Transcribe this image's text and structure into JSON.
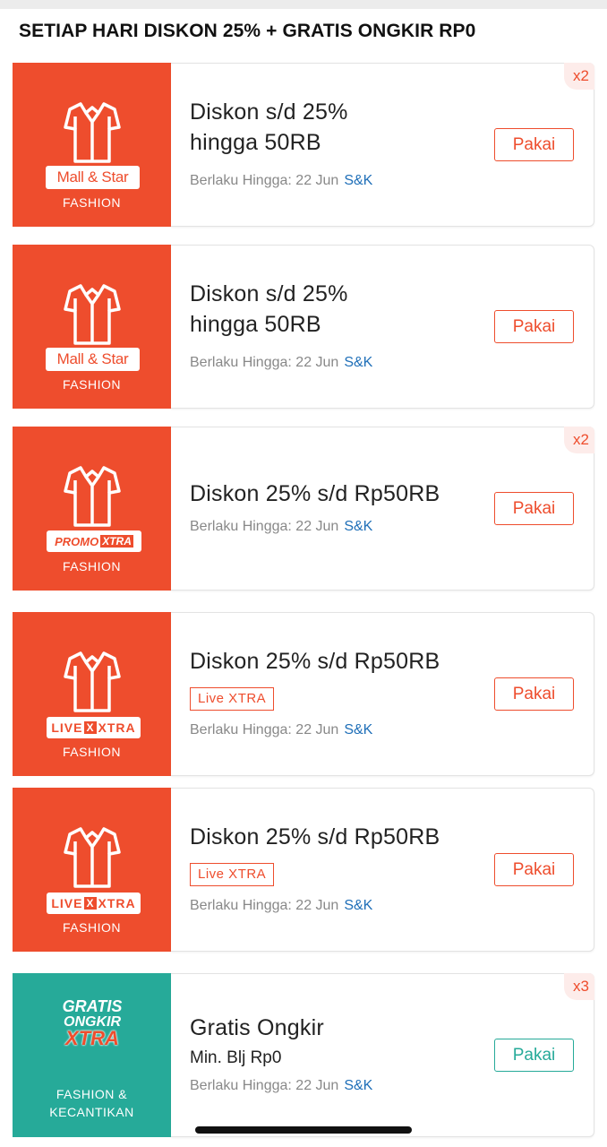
{
  "header": {
    "title": "SETIAP HARI DISKON 25% + GRATIS ONGKIR RP0"
  },
  "vouchers": [
    {
      "badge": "Mall & Star",
      "category": "FASHION",
      "title": "Diskon s/d 25%",
      "title2": "hingga 50RB",
      "validity": "Berlaku Hingga: 22 Jun",
      "terms": "S&K",
      "button": "Pakai",
      "multiplier": "x2"
    },
    {
      "badge": "Mall & Star",
      "category": "FASHION",
      "title": "Diskon s/d 25%",
      "title2": "hingga 50RB",
      "validity": "Berlaku Hingga: 22 Jun",
      "terms": "S&K",
      "button": "Pakai"
    },
    {
      "badge_a": "PROMO",
      "badge_b": "XTRA",
      "category": "FASHION",
      "title": "Diskon 25% s/d Rp50RB",
      "validity": "Berlaku Hingga: 22 Jun",
      "terms": "S&K",
      "button": "Pakai",
      "multiplier": "x2"
    },
    {
      "badge_a": "LIVE",
      "badge_x": "X",
      "badge_b": "XTRA",
      "category": "FASHION",
      "title": "Diskon 25% s/d Rp50RB",
      "tag": "Live XTRA",
      "validity": "Berlaku Hingga: 22 Jun",
      "terms": "S&K",
      "button": "Pakai"
    },
    {
      "badge_a": "LIVE",
      "badge_x": "X",
      "badge_b": "XTRA",
      "category": "FASHION",
      "title": "Diskon 25% s/d Rp50RB",
      "tag": "Live XTRA",
      "validity": "Berlaku Hingga: 22 Jun",
      "terms": "S&K",
      "button": "Pakai"
    },
    {
      "logo_line1": "GRATIS",
      "logo_line2": "ONGKIR",
      "logo_line3": "XTRA",
      "category_line1": "FASHION &",
      "category_line2": "KECANTIKAN",
      "title": "Gratis Ongkir",
      "subtitle": "Min. Blj Rp0",
      "validity": "Berlaku Hingga: 22 Jun",
      "terms": "S&K",
      "button": "Pakai",
      "multiplier": "x3"
    }
  ],
  "colors": {
    "brand": "#ee4d2d",
    "teal": "#26aa99",
    "link": "#1f6fb8",
    "muted": "#888888"
  },
  "icons": {
    "category": "shirt-icon"
  }
}
